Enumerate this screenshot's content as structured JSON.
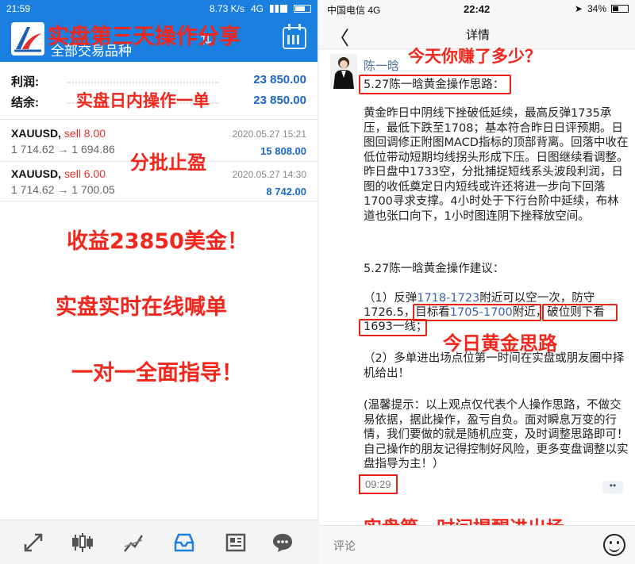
{
  "left": {
    "status": {
      "time": "21:59",
      "speed": "8.73 K/s",
      "network": "4G"
    },
    "header": {
      "subtitle": "全部交易品种"
    },
    "summary": {
      "profit_label": "利润:",
      "profit_value": "23 850.00",
      "balance_label": "结余:",
      "balance_value": "23 850.00"
    },
    "orders": [
      {
        "symbol": "XAUUSD,",
        "side": "sell 8.00",
        "prices": "1 714.62 → 1 694.86",
        "date": "2020.05.27 15:21",
        "profit": "15 808.00"
      },
      {
        "symbol": "XAUUSD,",
        "side": "sell 6.00",
        "prices": "1 714.62 → 1 700.05",
        "date": "2020.05.27 14:30",
        "profit": "8 742.00"
      }
    ],
    "overlays": {
      "title": "实盘第三天操作分享",
      "intraday": "实盘日内操作一单",
      "partial": "分批止盈",
      "income": "收益23850美金！",
      "live": "实盘实时在线喊单",
      "guide": "一对一全面指导！"
    },
    "nav_icons": [
      "trade-arrows-icon",
      "candlestick-icon",
      "line-chart-icon",
      "history-inbox-icon",
      "news-icon",
      "chat-icon"
    ]
  },
  "right": {
    "status": {
      "carrier": "中国电信",
      "network": "4G",
      "time": "22:42",
      "battery": "34%"
    },
    "nav": {
      "back": "〈",
      "title": "详情"
    },
    "author": "陈一晗",
    "post": {
      "heading1": "5.27陈一晗黄金操作思路：",
      "body1": "黄金昨日中阴线下挫破低延续，最高反弹1735承压，最低下跌至1708；基本符合昨日日评预期。日图回调修正附图MACD指标的顶部背离。回落中收在低位带动短期均线拐头形成下压。日图继续看调整。昨日盘中1733空，分批捕捉短线系头波段利润，日图的收低奠定日内短线或许还将进一步向下回落1700寻求支撑。4小时处于下行台阶中延续，布林道也张口向下，1小时图连阴下挫释放空间。",
      "heading2": "5.27陈一晗黄金操作建议：",
      "advice1_a": "（1）反弹",
      "advice1_range1": "1718-1723",
      "advice1_b": "附近可以空一次，防守1726.5，目标看",
      "advice1_range2": "1705-1700",
      "advice1_c": "附近，破位则下看1693一线；",
      "advice2": "（2）多单进出场点位第一时间在实盘或朋友圈中择机给出！",
      "tip": "(温馨提示：以上观点仅代表个人操作思路，不做交易依据，据此操作，盈亏自负。面对瞬息万变的行情，我们要做的就是随机应变，及时调整思路即可！自己操作的朋友记得控制好风险，更多变盘调整以实盘指导为主！）",
      "time": "09:29",
      "more": "••"
    },
    "overlays": {
      "question": "今天你赚了多少？",
      "idea": "今日黄金思路",
      "remind": "实盘第一时间提醒进出场"
    },
    "comment_placeholder": "评论"
  },
  "colors": {
    "blue": "#1b7fe0",
    "red_overlay": "#f3261c",
    "profit_blue": "#1b66c9",
    "sell_red": "#e0312a",
    "link_blue": "#3a63b0"
  }
}
